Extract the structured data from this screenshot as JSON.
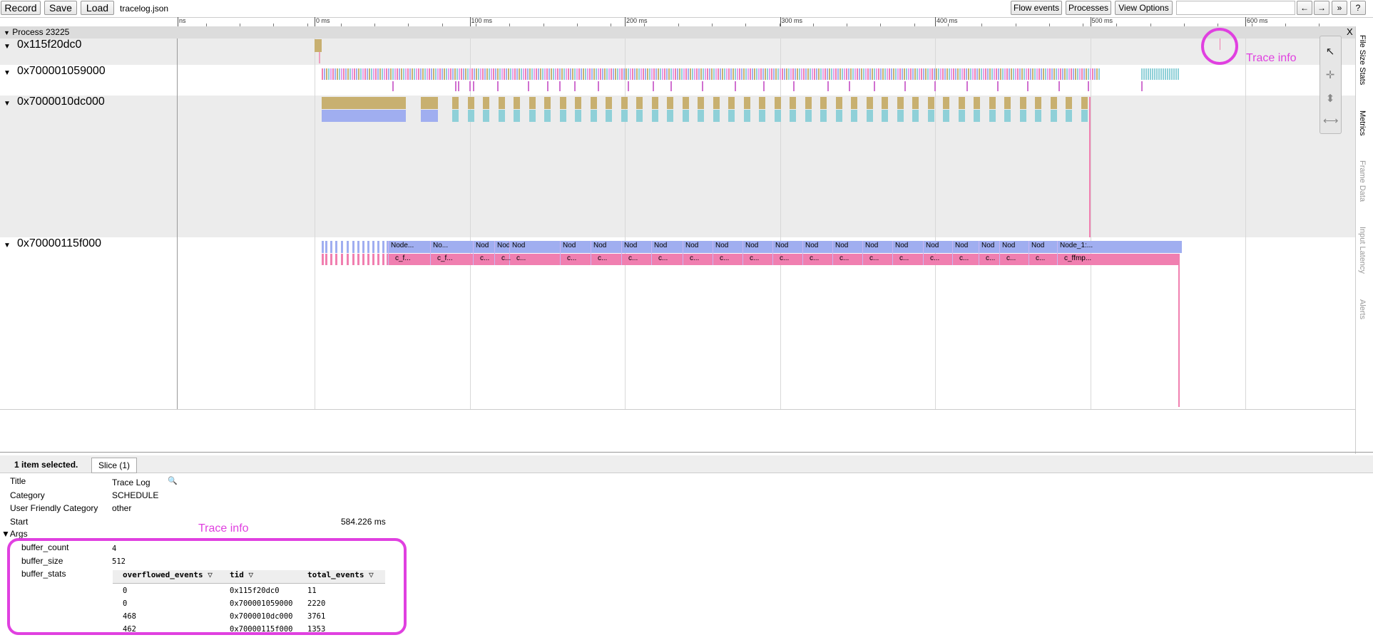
{
  "toolbar": {
    "record": "Record",
    "save": "Save",
    "load": "Load",
    "filename": "tracelog.json",
    "flow_events": "Flow events",
    "processes": "Processes",
    "view_options": "View Options",
    "nav_back": "←",
    "nav_fwd": "→",
    "more": "»",
    "help": "?"
  },
  "ruler": {
    "labels": [
      "ns",
      "0 ms",
      "100 ms",
      "200 ms",
      "300 ms",
      "400 ms",
      "500 ms",
      "600 ms"
    ]
  },
  "process": {
    "label": "Process 23225",
    "close": "X"
  },
  "threads": [
    {
      "name": "0x115f20dc0"
    },
    {
      "name": "0x700001059000"
    },
    {
      "name": "0x7000010dc000"
    },
    {
      "name": "0x70000115f000"
    }
  ],
  "slice_labels": {
    "top": [
      "Node...",
      "No...",
      "Nod",
      "Nod",
      "Nod",
      "Nod",
      "Nod",
      "Nod",
      "Nod",
      "Nod",
      "Nod",
      "Nod",
      "Nod",
      "Nod",
      "Nod",
      "Nod",
      "Nod",
      "Nod",
      "Nod",
      "Nod",
      "Nod",
      "Nod",
      "Node_1:..."
    ],
    "bottom": [
      "c_f...",
      "c_f...",
      "c...",
      "c...",
      "c...",
      "c...",
      "c...",
      "c...",
      "c...",
      "c...",
      "c...",
      "c...",
      "c...",
      "c...",
      "c...",
      "c...",
      "c...",
      "c...",
      "c...",
      "c...",
      "c...",
      "c...",
      "c_ffmp..."
    ]
  },
  "side_tabs": [
    "File Size Stats",
    "Metrics",
    "Frame Data",
    "Input Latency",
    "Alerts"
  ],
  "annotations": {
    "top": "Trace info",
    "bottom": "Trace info"
  },
  "colors": {
    "annotation": "#e040e0",
    "slice_blue": "#a0aef0",
    "slice_pink": "#f07fb0"
  },
  "details": {
    "selected": "1 item selected.",
    "tab": "Slice (1)",
    "title_label": "Title",
    "title_value": "Trace Log",
    "category_label": "Category",
    "category_value": "SCHEDULE",
    "ufc_label": "User Friendly Category",
    "ufc_value": "other",
    "start_label": "Start",
    "start_value": "584.226 ms",
    "args_label": "Args",
    "buffer_count_label": "buffer_count",
    "buffer_count_value": "4",
    "buffer_size_label": "buffer_size",
    "buffer_size_value": "512",
    "buffer_stats_label": "buffer_stats",
    "table": {
      "headers": [
        "overflowed_events",
        "tid",
        "total_events"
      ],
      "rows": [
        [
          "0",
          "0x115f20dc0",
          "11"
        ],
        [
          "0",
          "0x700001059000",
          "2220"
        ],
        [
          "468",
          "0x7000010dc000",
          "3761"
        ],
        [
          "462",
          "0x70000115f000",
          "1353"
        ]
      ]
    }
  }
}
